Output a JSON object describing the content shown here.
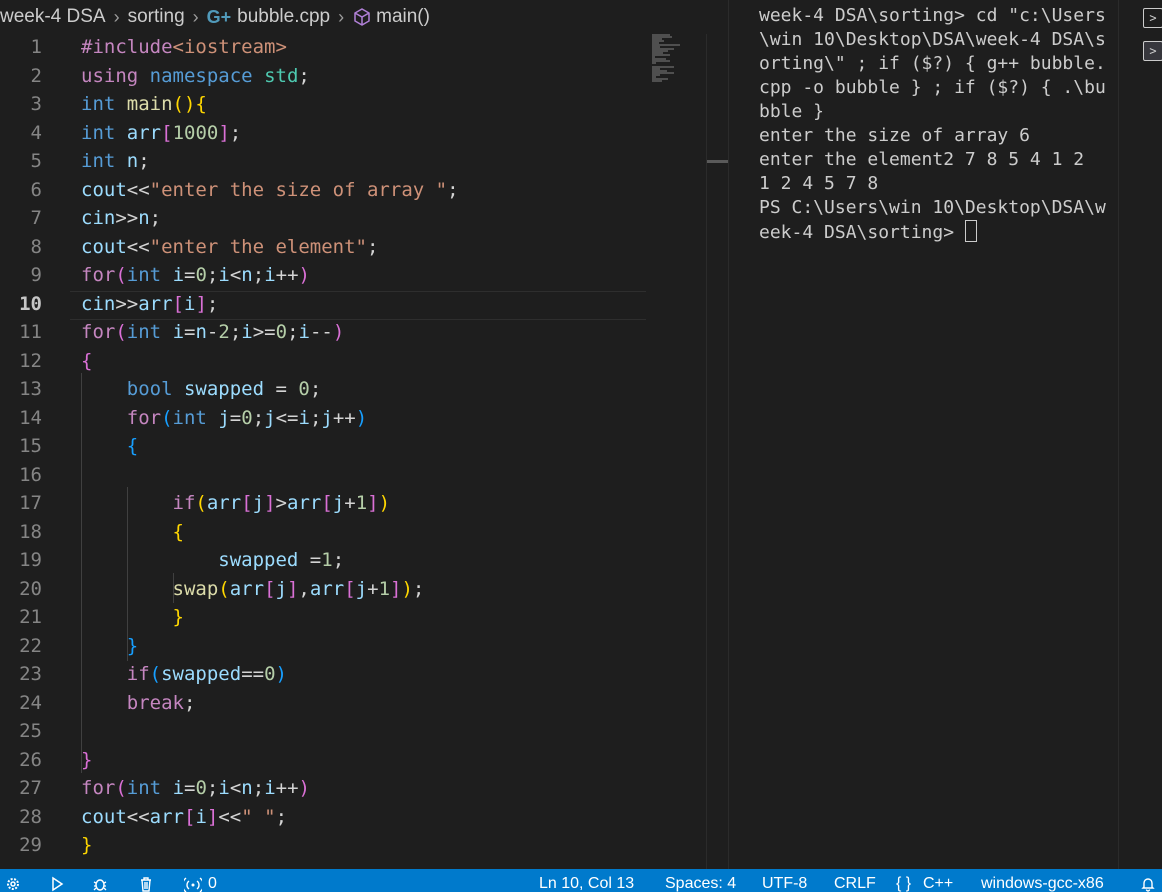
{
  "breadcrumb": {
    "folder": "week-4 DSA",
    "subfolder": "sorting",
    "file": "bubble.cpp",
    "symbol": "main()"
  },
  "editor": {
    "active_line": 10,
    "line_numbers": [
      "1",
      "2",
      "3",
      "4",
      "5",
      "6",
      "7",
      "8",
      "9",
      "10",
      "11",
      "12",
      "13",
      "14",
      "15",
      "16",
      "17",
      "18",
      "19",
      "20",
      "21",
      "22",
      "23",
      "24",
      "25",
      "26",
      "27",
      "28",
      "29"
    ]
  },
  "terminal": {
    "lines": [
      "week-4 DSA\\sorting> cd \"c:\\Users\\win 10\\Desktop\\DSA\\week-4 DSA\\sorting\\\" ; if ($?) { g++ bubble.cpp -o bubble } ; if ($?) { .\\bubble }",
      "enter the size of array 6",
      "enter the element2 7 8 5 4 1 2",
      "1 2 4 5 7 8",
      "PS C:\\Users\\win 10\\Desktop\\DSA\\week-4 DSA\\sorting> "
    ]
  },
  "statusbar": {
    "ports": "0",
    "position": "Ln 10, Col 13",
    "spaces": "Spaces: 4",
    "encoding": "UTF-8",
    "eol": "CRLF",
    "language": "C++",
    "config": "windows-gcc-x86"
  },
  "colors": {
    "statusbar_bg": "#007acc",
    "editor_bg": "#1e1e1e",
    "keyword": "#569cd6",
    "string": "#ce9178",
    "function": "#dcdcaa",
    "variable": "#9cdcfe",
    "number": "#b5cea8",
    "control": "#c586c0"
  }
}
